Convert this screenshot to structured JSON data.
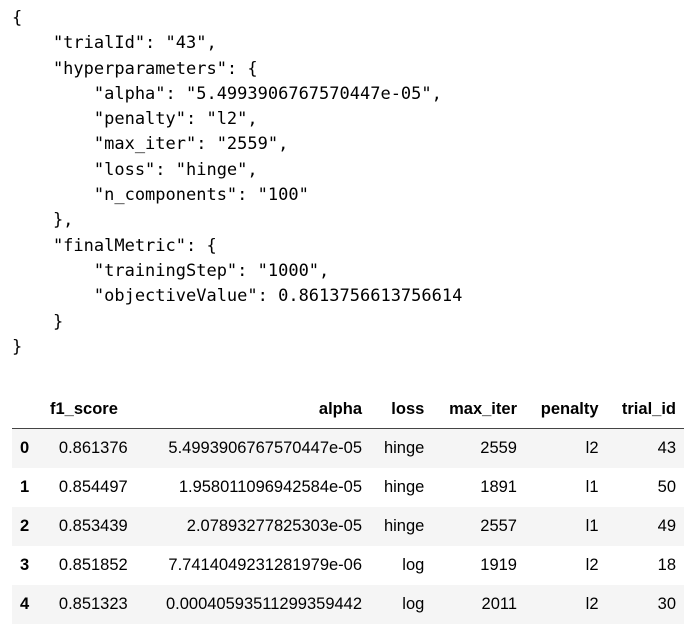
{
  "json_output": {
    "lines": [
      "{",
      "    \"trialId\": \"43\",",
      "    \"hyperparameters\": {",
      "        \"alpha\": \"5.4993906767570447e-05\",",
      "        \"penalty\": \"l2\",",
      "        \"max_iter\": \"2559\",",
      "        \"loss\": \"hinge\",",
      "        \"n_components\": \"100\"",
      "    },",
      "    \"finalMetric\": {",
      "        \"trainingStep\": \"1000\",",
      "        \"objectiveValue\": 0.8613756613756614",
      "    }",
      "}"
    ]
  },
  "table": {
    "index_header": "",
    "columns": [
      "f1_score",
      "alpha",
      "loss",
      "max_iter",
      "penalty",
      "trial_id"
    ],
    "rows": [
      {
        "index": "0",
        "cells": [
          "0.861376",
          "5.4993906767570447e-05",
          "hinge",
          "2559",
          "l2",
          "43"
        ]
      },
      {
        "index": "1",
        "cells": [
          "0.854497",
          "1.958011096942584e-05",
          "hinge",
          "1891",
          "l1",
          "50"
        ]
      },
      {
        "index": "2",
        "cells": [
          "0.853439",
          "2.07893277825303e-05",
          "hinge",
          "2557",
          "l1",
          "49"
        ]
      },
      {
        "index": "3",
        "cells": [
          "0.851852",
          "7.7414049231281979e-06",
          "log",
          "1919",
          "l2",
          "18"
        ]
      },
      {
        "index": "4",
        "cells": [
          "0.851323",
          "0.00040593511299359442",
          "log",
          "2011",
          "l2",
          "30"
        ]
      }
    ]
  }
}
